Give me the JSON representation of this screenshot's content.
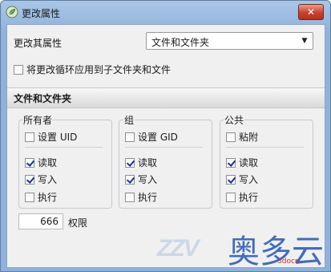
{
  "window": {
    "title": "更改属性",
    "close_label": "✕"
  },
  "top": {
    "change_label": "更改其属性",
    "select_value": "文件和文件夹",
    "recursive_label": "将更改循环应用到子文件夹和文件"
  },
  "section": {
    "title": "文件和文件夹"
  },
  "groups": [
    {
      "label": "所有者",
      "special": "设置 UID",
      "read": "读取",
      "write": "写入",
      "exec": "执行"
    },
    {
      "label": "组",
      "special": "设置 GID",
      "read": "读取",
      "write": "写入",
      "exec": "执行"
    },
    {
      "label": "公共",
      "special": "粘附",
      "read": "读取",
      "write": "写入",
      "exec": "执行"
    }
  ],
  "permissions": {
    "value": "666",
    "label": "权限"
  },
  "watermark": {
    "logo": "ZZV",
    "brand": "奥多云",
    "url": "3docn"
  },
  "colors": {
    "title_bg": "#8fb2db",
    "close_bg": "#c8412c",
    "check": "#1e2f8e"
  }
}
